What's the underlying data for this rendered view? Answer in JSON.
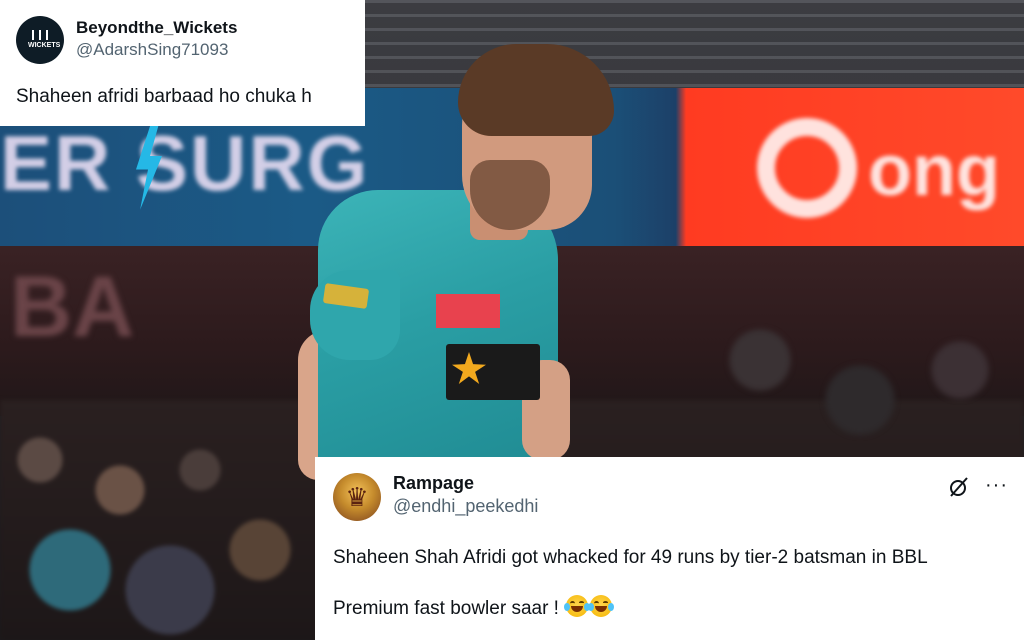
{
  "top_tweet": {
    "display_name": "Beyondthe_Wickets",
    "handle": "@AdarshSing71093",
    "text": "Shaheen afridi barbaad ho chuka h",
    "avatar_logo_text": "WICKETS"
  },
  "bottom_tweet": {
    "display_name": "Rampage",
    "handle": "@endhi_peekedhi",
    "text_line1": "Shaheen Shah Afridi got whacked for 49 runs by tier-2 batsman in BBL",
    "text_line2": "Premium fast bowler saar !",
    "emojis": [
      "face-with-tears-of-joy",
      "face-with-tears-of-joy"
    ],
    "icons": [
      "grok-icon",
      "more-icon"
    ]
  },
  "background": {
    "board_text_left": "ER SURG",
    "board_text_right": "ong",
    "wall_text": "BA",
    "colors": {
      "jersey": "#2a9ea4",
      "board_blue": "#1b5a86",
      "board_orange": "#ff3b21"
    }
  }
}
